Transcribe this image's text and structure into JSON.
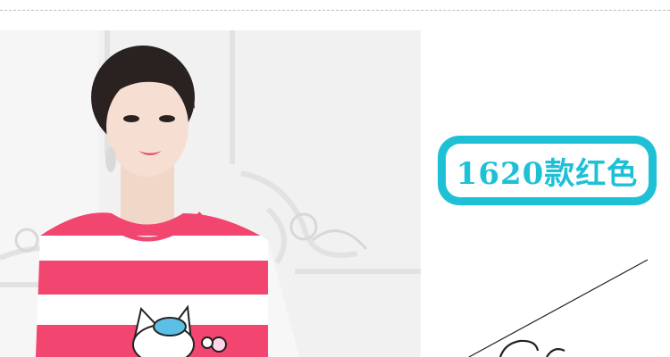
{
  "product_label": {
    "text": "1620款红色"
  },
  "colors": {
    "badge_accent": "#1ec0d6",
    "shirt_stripe_pink": "#f2456f",
    "background": "#ffffff"
  },
  "photo": {
    "icon": "model-photo"
  },
  "icons": {
    "cartoon_cat_print": "cartoon-cat-icon"
  }
}
